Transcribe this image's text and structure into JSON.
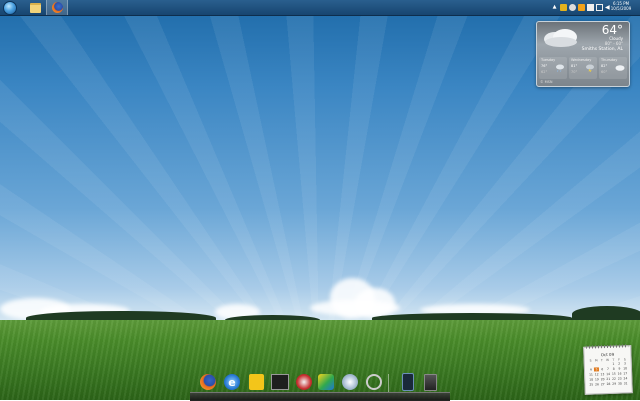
{
  "taskbar": {
    "start_button_icon": "windows-orb-icon",
    "pinned": [
      {
        "name": "explorer",
        "icon": "folder-icon"
      },
      {
        "name": "firefox",
        "icon": "firefox-icon",
        "active": true
      }
    ],
    "tray_icons": [
      "show-hidden-icon",
      "security-icon",
      "connection-icon",
      "updates-icon",
      "flag-icon",
      "network-icon",
      "volume-icon"
    ],
    "clock": {
      "time": "6:15 PM",
      "date": "10/5/2009"
    }
  },
  "weather": {
    "temperature": "64°",
    "condition": "Cloudy",
    "range": "80° - 60°",
    "location": "Smiths Station, AL",
    "forecast": [
      {
        "day": "Tuesday",
        "high": "76°",
        "low": "62°",
        "icon": "rain-icon"
      },
      {
        "day": "Wednesday",
        "high": "81°",
        "low": "70°",
        "icon": "storm-icon"
      },
      {
        "day": "Thursday",
        "high": "82°",
        "low": "60°",
        "icon": "cloud-icon"
      }
    ],
    "source": "© MSN"
  },
  "calendar": {
    "month": "Oct 09",
    "weekdays": [
      "S",
      "M",
      "T",
      "W",
      "T",
      "F",
      "S"
    ],
    "days": [
      "",
      "",
      "",
      "",
      "1",
      "2",
      "3",
      "4",
      "5",
      "6",
      "7",
      "8",
      "9",
      "10",
      "11",
      "12",
      "13",
      "14",
      "15",
      "16",
      "17",
      "18",
      "19",
      "20",
      "21",
      "22",
      "23",
      "24",
      "25",
      "26",
      "27",
      "28",
      "29",
      "30",
      "31"
    ],
    "today": "5"
  },
  "dock": {
    "items": [
      {
        "name": "firefox",
        "icon": "firefox-icon"
      },
      {
        "name": "internet-explorer",
        "icon": "internet-explorer-icon",
        "glyph": "e"
      },
      {
        "name": "adium",
        "icon": "duck-icon"
      },
      {
        "name": "photo-viewer",
        "icon": "photo-icon"
      },
      {
        "name": "media-app",
        "icon": "media-icon"
      },
      {
        "name": "media-player",
        "icon": "play-icon"
      },
      {
        "name": "itunes",
        "icon": "cd-icon"
      },
      {
        "name": "audio",
        "icon": "headphones-icon"
      },
      {
        "name": "phone",
        "icon": "phone-icon"
      },
      {
        "name": "recycle-bin",
        "icon": "trash-icon"
      }
    ]
  }
}
